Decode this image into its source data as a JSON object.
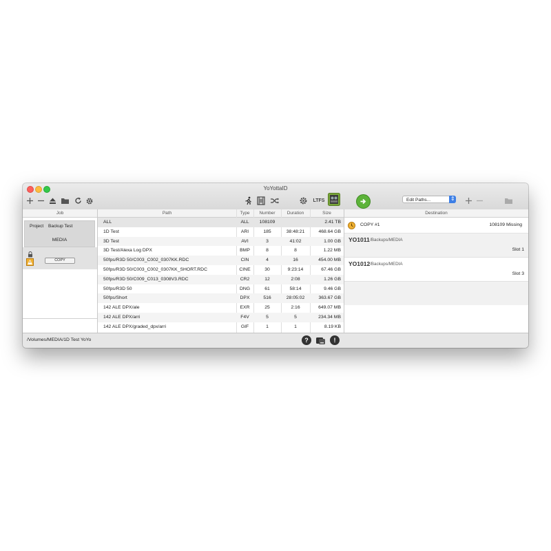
{
  "window": {
    "title": "YoYottaID"
  },
  "toolbar": {
    "ltfs_label": "LTFS",
    "edit_paths": "Edit Paths..."
  },
  "job": {
    "header": "Job",
    "project_label": "Project",
    "project_name": "Backup Test",
    "media": "MEDIA",
    "copy_button": "COPY"
  },
  "path_table": {
    "headers": {
      "path": "Path",
      "type": "Type",
      "number": "Number",
      "duration": "Duration",
      "size": "Size"
    },
    "rows": [
      {
        "path": "ALL",
        "type": "ALL",
        "number": "108109",
        "duration": "",
        "size": "2.41 TB"
      },
      {
        "path": "1D Test",
        "type": "ARI",
        "number": "185",
        "duration": "38:48:21",
        "size": "468.64 GB"
      },
      {
        "path": "3D Test",
        "type": "AVI",
        "number": "3",
        "duration": "41:02",
        "size": "1.00 GB"
      },
      {
        "path": "3D Test/Alexa Log DPX",
        "type": "BMP",
        "number": "8",
        "duration": "8",
        "size": "1.22 MB"
      },
      {
        "path": "50fps/R3D 50/C003_C002_0307KK.RDC",
        "type": "CIN",
        "number": "4",
        "duration": "16",
        "size": "454.00 MB"
      },
      {
        "path": "50fps/R3D 50/C003_C002_0307KK_SHORT.RDC",
        "type": "CINE",
        "number": "30",
        "duration": "9:23:14",
        "size": "67.46 GB"
      },
      {
        "path": "50fps/R3D 50/C009_C013_0308V3.RDC",
        "type": "CR2",
        "number": "12",
        "duration": "2:08",
        "size": "1.26 GB"
      },
      {
        "path": "50fps/R3D 50",
        "type": "DNG",
        "number": "61",
        "duration": "58:14",
        "size": "9.46 GB"
      },
      {
        "path": "50fps/Short",
        "type": "DPX",
        "number": "516",
        "duration": "28:05:02",
        "size": "363.67 GB"
      },
      {
        "path": "142 ALE DPX/ale",
        "type": "EXR",
        "number": "25",
        "duration": "2:16",
        "size": "649.07 MB"
      },
      {
        "path": "142 ALE DPX/arri",
        "type": "F4V",
        "number": "5",
        "duration": "5",
        "size": "234.34 MB"
      },
      {
        "path": "142 ALE DPX/graded_dpx/arri",
        "type": "GIF",
        "number": "1",
        "duration": "1",
        "size": "8.19 KB"
      }
    ]
  },
  "destination": {
    "header": "Destination",
    "copy_label": "COPY #1",
    "missing": "108109 Missing",
    "entries": [
      {
        "tape": "YO1011",
        "path": "/Backups/MEDIA",
        "slot": "Slot 1"
      },
      {
        "tape": "YO1012",
        "path": "/Backups/MEDIA",
        "slot": "Slot 3"
      }
    ]
  },
  "status": {
    "path": "/Volumes/MEDIA/1D Test YoYo"
  },
  "colors": {
    "go_green": "#5db33a",
    "ltfs_green": "#7aa83a",
    "accent_blue": "#3d7fe6"
  }
}
